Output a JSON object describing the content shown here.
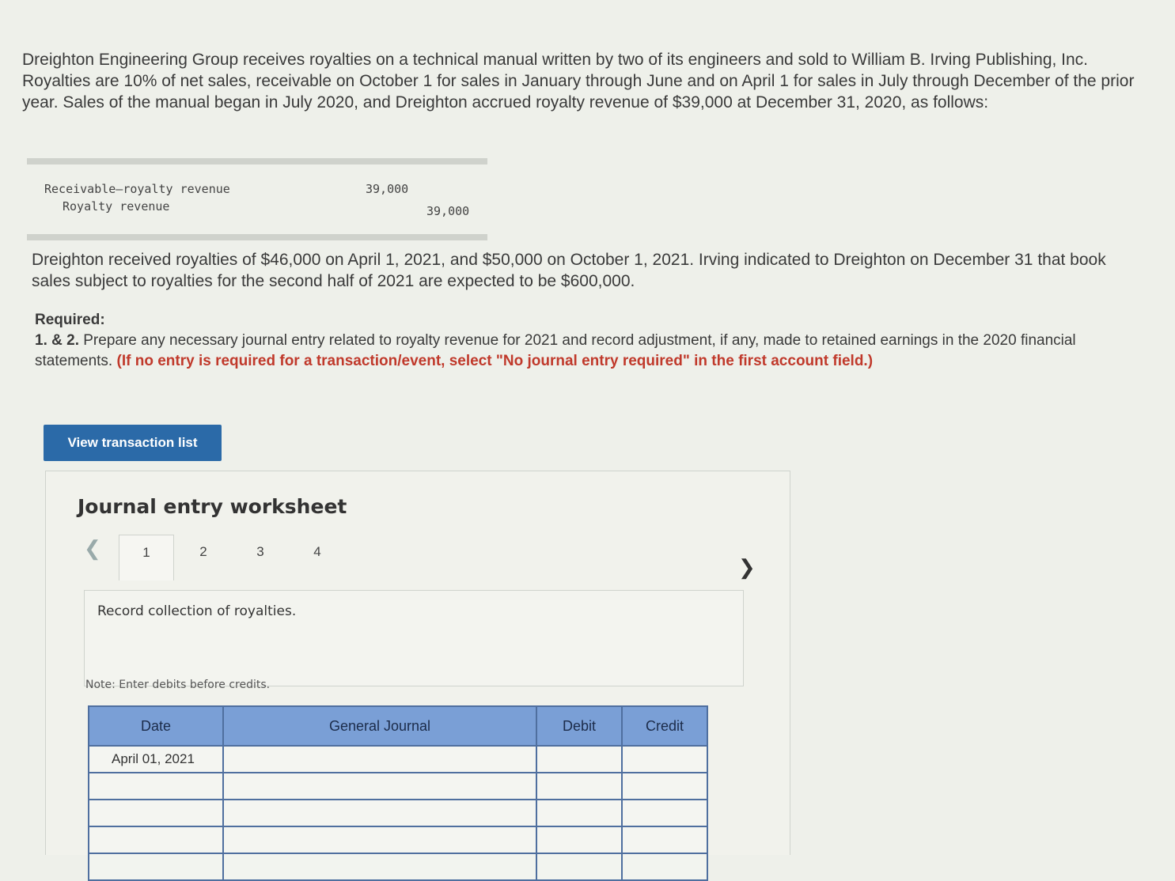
{
  "intro": "Dreighton Engineering Group receives royalties on a technical manual written by two of its engineers and sold to William B. Irving Publishing, Inc. Royalties are 10% of net sales, receivable on October 1 for sales in January through June and on April 1 for sales in July through December of the prior year. Sales of the manual began in July 2020, and Dreighton accrued royalty revenue of $39,000 at December 31, 2020, as follows:",
  "accrual": {
    "debit_account": "Receivable–royalty revenue",
    "debit_amount": "39,000",
    "credit_account": "Royalty revenue",
    "credit_amount": "39,000"
  },
  "para2": "Dreighton received royalties of $46,000 on April 1, 2021, and $50,000 on October 1, 2021. Irving indicated to Dreighton on December 31 that book sales subject to royalties for the second half of 2021 are expected to be $600,000.",
  "required": {
    "heading": "Required:",
    "number": "1. & 2.",
    "text": " Prepare any necessary journal entry related to royalty revenue for 2021 and record adjustment, if any, made to retained earnings in the 2020 financial statements. ",
    "instruction": "(If no entry is required for a transaction/event, select \"No journal entry required\" in the first account field.)"
  },
  "view_button": "View transaction list",
  "worksheet": {
    "title": "Journal entry worksheet",
    "tabs": [
      "1",
      "2",
      "3",
      "4"
    ],
    "active_tab": "1",
    "prompt": "Record collection of royalties.",
    "note": "Note: Enter debits before credits.",
    "table": {
      "headers": {
        "date": "Date",
        "general_journal": "General Journal",
        "debit": "Debit",
        "credit": "Credit"
      },
      "rows": [
        {
          "date": "April 01, 2021"
        },
        {
          "date": ""
        },
        {
          "date": ""
        },
        {
          "date": ""
        },
        {
          "date": ""
        }
      ]
    }
  },
  "colors": {
    "button": "#2b6aa8",
    "header_blue": "#7a9fd6",
    "instruction_red": "#c0392b"
  }
}
